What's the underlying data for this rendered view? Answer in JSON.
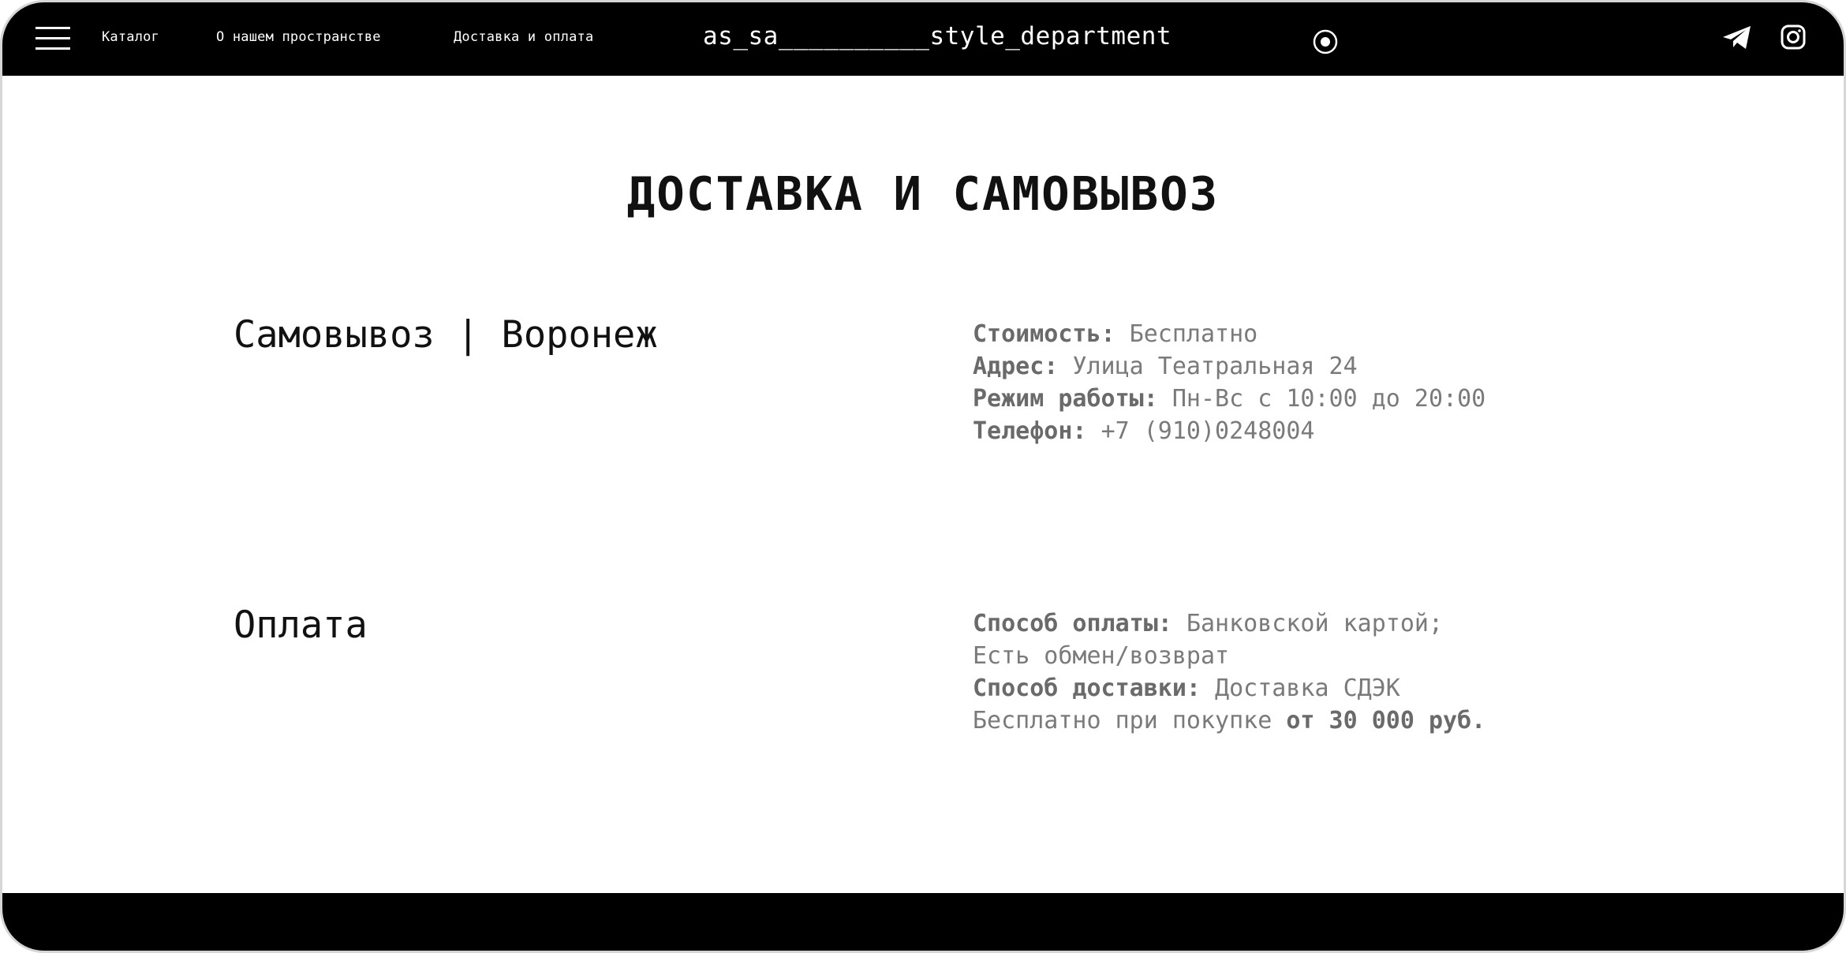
{
  "header": {
    "menu_icon": "hamburger-menu-icon",
    "nav": [
      "Каталог",
      "О нашем пространстве",
      "Доставка и оплата"
    ],
    "brand": "as_sa__________style_department",
    "icons": [
      "radio-button-icon",
      "telegram-icon",
      "instagram-icon"
    ]
  },
  "main": {
    "title": "ДОСТАВКА И САМОВЫВОЗ",
    "pickup": {
      "heading": "Самовывоз | Воронеж",
      "cost_label": "Стоимость:",
      "cost_value": "Бесплатно",
      "address_label": "Адрес:",
      "address_value": "Улица Театральная 24",
      "hours_label": "Режим работы:",
      "hours_value": "Пн-Вс с 10:00 до 20:00",
      "phone_label": "Телефон:",
      "phone_value": "+7 (910)0248004"
    },
    "payment": {
      "heading": "Оплата",
      "method_label": "Способ оплаты:",
      "method_value": "Банковской картой;",
      "exchange": "Есть обмен/возврат",
      "delivery_label": "Способ доставки:",
      "delivery_value": "Доставка СДЭК",
      "free_text": "Бесплатно при покупке",
      "free_threshold": "от 30 000 руб."
    }
  },
  "colors": {
    "bar": "#000000",
    "text": "#111111",
    "muted": "#7a7a7a"
  }
}
